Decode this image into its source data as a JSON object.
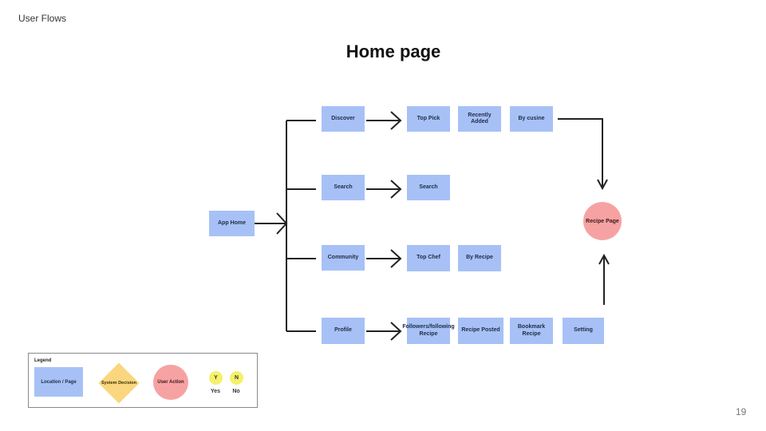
{
  "header": {
    "section_label": "User Flows",
    "title": "Home page"
  },
  "footer": {
    "page_number": "19"
  },
  "diagram": {
    "start": "App Home",
    "sections": {
      "discover": {
        "label": "Discover",
        "items": [
          "Top Pick",
          "Recently Added",
          "By cusine"
        ]
      },
      "search": {
        "label": "Search",
        "items": [
          "Search"
        ]
      },
      "community": {
        "label": "Community",
        "items": [
          "Top Chef",
          "By Recipe"
        ]
      },
      "profile": {
        "label": "Profile",
        "items": [
          "Followers/following Recipe",
          "Recipe Posted",
          "Bookmark Recipe",
          "Setting"
        ]
      }
    },
    "destination": "Recipe Page"
  },
  "legend": {
    "title": "Legend",
    "location_page": "Location / Page",
    "system_decision": "System Decision",
    "user_action": "User Action",
    "yes_symbol": "Y",
    "yes_label": "Yes",
    "no_symbol": "N",
    "no_label": "No"
  },
  "colors": {
    "location": "#a7c1f7",
    "decision": "#fad77e",
    "action": "#f7a2a2",
    "yes_no": "#f4f16a"
  }
}
